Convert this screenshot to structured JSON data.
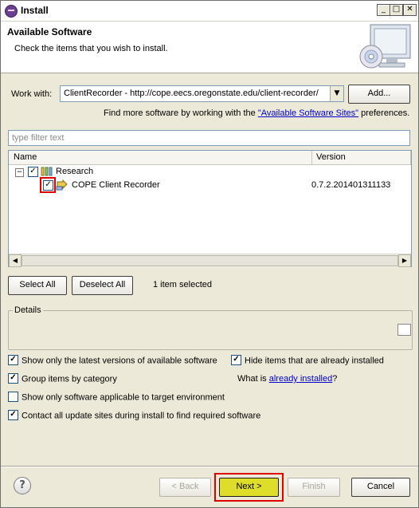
{
  "window": {
    "title": "Install"
  },
  "header": {
    "title": "Available Software",
    "subtitle": "Check the items that you wish to install."
  },
  "work_with": {
    "label": "Work with:",
    "value": "ClientRecorder - http://cope.eecs.oregonstate.edu/client-recorder/",
    "add_label": "Add..."
  },
  "sites_hint": {
    "prefix": "Find more software by working with the ",
    "link": "\"Available Software Sites\"",
    "suffix": " preferences."
  },
  "filter": {
    "placeholder": "type filter text"
  },
  "tree": {
    "columns": [
      "Name",
      "Version"
    ],
    "category": {
      "label": "Research",
      "checked": true,
      "expanded": true
    },
    "item": {
      "label": "COPE Client Recorder",
      "version": "0.7.2.201401311133",
      "checked": true
    }
  },
  "selection": {
    "select_all": "Select All",
    "deselect_all": "Deselect All",
    "status": "1 item selected"
  },
  "details": {
    "title": "Details"
  },
  "options": {
    "latest_only": {
      "label": "Show only the latest versions of available software",
      "checked": true
    },
    "hide_installed": {
      "label": "Hide items that are already installed",
      "checked": true
    },
    "group_by_category": {
      "label": "Group items by category",
      "checked": true
    },
    "what_is_prefix": "What is ",
    "already_installed_link": "already installed",
    "what_is_suffix": "?",
    "target_env": {
      "label": "Show only software applicable to target environment",
      "checked": false
    },
    "contact_sites": {
      "label": "Contact all update sites during install to find required software",
      "checked": true
    }
  },
  "footer": {
    "help_label": "?",
    "back": "< Back",
    "next": "Next >",
    "finish": "Finish",
    "cancel": "Cancel"
  },
  "colors": {
    "highlight": "#e00000",
    "next_button": "#dede2a",
    "link": "#0000cc"
  }
}
